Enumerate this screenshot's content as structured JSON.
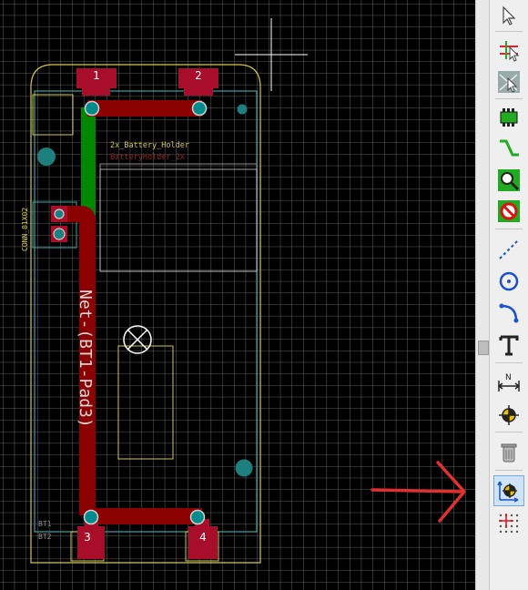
{
  "pcb": {
    "pads": [
      "1",
      "2",
      "3",
      "4"
    ],
    "footprint_name": "2x_Battery_Holder",
    "footprint_value": "BatteryHolder_2x",
    "connector_ref": "CONN_01X02",
    "net_label": "Net-(BT1-Pad3)",
    "ref_bt1": "BT1",
    "ref_bt2": "BT2"
  },
  "toolbar": {
    "tools": [
      {
        "name": "select-tool",
        "icon": "arrow-cursor-icon"
      },
      {
        "name": "highlight-net-tool",
        "icon": "highlight-net-icon"
      },
      {
        "name": "local-ratsnest-tool",
        "icon": "ratsnest-icon"
      },
      {
        "name": "add-footprint-tool",
        "icon": "footprint-icon"
      },
      {
        "name": "route-tracks-tool",
        "icon": "route-track-icon"
      },
      {
        "name": "add-via-tool",
        "icon": "via-icon"
      },
      {
        "name": "add-keepout-tool",
        "icon": "keepout-icon"
      },
      {
        "name": "draw-line-tool",
        "icon": "dashed-line-icon"
      },
      {
        "name": "draw-circle-tool",
        "icon": "circle-icon"
      },
      {
        "name": "draw-arc-tool",
        "icon": "arc-icon"
      },
      {
        "name": "add-text-tool",
        "icon": "text-icon"
      },
      {
        "name": "add-dimension-tool",
        "icon": "dimension-icon"
      },
      {
        "name": "layer-alignment-target-tool",
        "icon": "target-icon"
      },
      {
        "name": "delete-tool",
        "icon": "trash-icon"
      },
      {
        "name": "set-drill-origin-tool",
        "icon": "drill-origin-icon"
      },
      {
        "name": "set-grid-origin-tool",
        "icon": "grid-origin-icon"
      }
    ]
  },
  "colors": {
    "background": "#000000",
    "grid": "#8a8a8a",
    "copper_front": "#8b0000",
    "copper_back": "#008800",
    "pad": "#a80d2a",
    "via": "#1e7f7f",
    "silkscreen": "#d4c64a",
    "courtyard": "#3aa3a3",
    "annotation_arrow": "#e03030"
  }
}
